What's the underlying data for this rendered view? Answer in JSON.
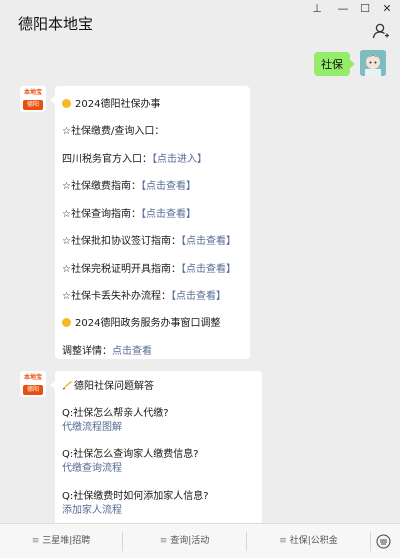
{
  "window": {
    "title": "德阳本地宝"
  },
  "chat": {
    "my_message": "社保",
    "msg1": {
      "title": "2024德阳社保办事",
      "l1": "☆社保缴费/查询入口：",
      "l2_text": "四川税务官方入口：",
      "l2_link": "【点击进入】",
      "l3_text": "☆社保缴费指南：",
      "l3_link": "【点击查看】",
      "l4_text": "☆社保查询指南：",
      "l4_link": "【点击查看】",
      "l5_text": "☆社保批扣协议签订指南：",
      "l5_link": "【点击查看】",
      "l6_text": "☆社保完税证明开具指南：",
      "l6_link": "【点击查看】",
      "l7_text": "☆社保卡丢失补办流程：",
      "l7_link": "【点击查看】",
      "l8": "2024德阳政务服务办事窗口调整",
      "l9_text": "调整详情：",
      "l9_link": "点击查看"
    },
    "msg2": {
      "title": "德阳社保问题解答",
      "q1": "Q:社保怎么帮亲人代缴?",
      "a1": "代缴流程图解",
      "q2": "Q:社保怎么查询家人缴费信息?",
      "a2": "代缴查询流程",
      "q3": "Q:社保缴费时如何添加家人信息?",
      "a3": "添加家人流程"
    },
    "bot_avatar": {
      "top": "本地宝",
      "bottom": "德阳"
    }
  },
  "bottom_menu": {
    "tab1": "三星堆|招聘",
    "tab2": "查询|活动",
    "tab3": "社保|公积金",
    "menu_glyph": "≡"
  },
  "window_controls": {
    "pin": "⊥",
    "minimize": "—",
    "maximize": "☐",
    "close": "✕"
  },
  "colors": {
    "link": "#576b95",
    "my_bubble": "#95ec69",
    "background": "#ededed"
  }
}
